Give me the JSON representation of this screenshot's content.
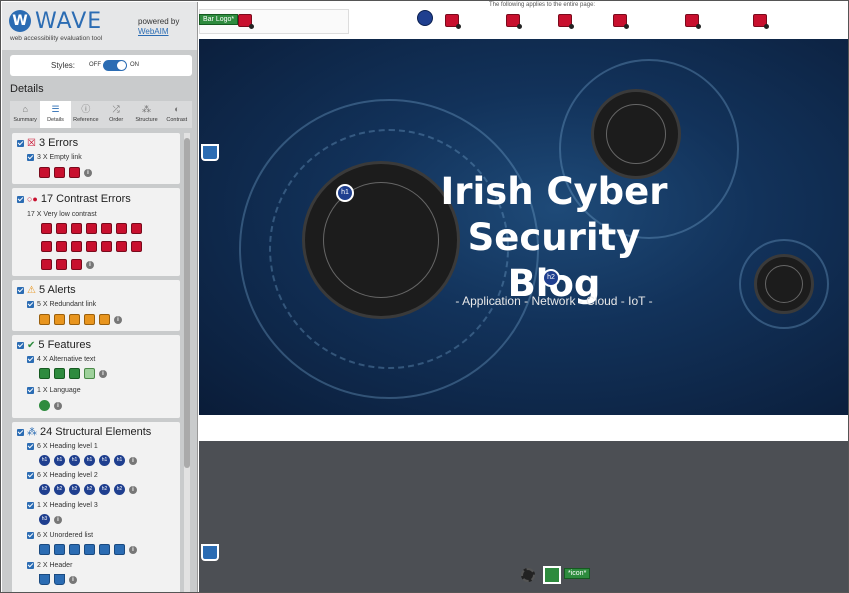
{
  "wave": {
    "logo_letter": "W",
    "title": "WAVE",
    "subtitle": "web accessibility evaluation tool",
    "powered_by": "powered by",
    "webaim": "WebAIM",
    "styles_label": "Styles:",
    "styles_off": "OFF",
    "styles_on": "ON",
    "details_heading": "Details",
    "tabs": [
      {
        "label": "Summary",
        "icon": "home-icon"
      },
      {
        "label": "Details",
        "icon": "list-icon"
      },
      {
        "label": "Reference",
        "icon": "info-icon"
      },
      {
        "label": "Order",
        "icon": "order-icon"
      },
      {
        "label": "Structure",
        "icon": "structure-icon"
      },
      {
        "label": "Contrast",
        "icon": "contrast-icon"
      }
    ],
    "active_tab": "Details",
    "sections": {
      "errors": {
        "title": "3 Errors",
        "items": [
          {
            "label": "3 X Empty link",
            "count": 3
          }
        ]
      },
      "contrast": {
        "title": "17 Contrast Errors",
        "items": [
          {
            "label": "17 X Very low contrast",
            "count": 17
          }
        ]
      },
      "alerts": {
        "title": "5 Alerts",
        "items": [
          {
            "label": "5 X Redundant link",
            "count": 5
          }
        ]
      },
      "features": {
        "title": "5 Features",
        "items": [
          {
            "label": "4 X Alternative text",
            "count": 4
          },
          {
            "label": "1 X Language",
            "count": 1
          }
        ]
      },
      "structure": {
        "title": "24 Structural Elements",
        "items": [
          {
            "label": "6 X Heading level 1",
            "count": 6
          },
          {
            "label": "6 X Heading level 2",
            "count": 6
          },
          {
            "label": "1 X Heading level 3",
            "count": 1
          },
          {
            "label": "6 X Unordered list",
            "count": 6
          },
          {
            "label": "2 X Header",
            "count": 2
          }
        ]
      }
    },
    "info_glyph": "i"
  },
  "page": {
    "top_note": "The following applies to the entire page:",
    "logo_tag": "Bar Logo*",
    "hero_title_line1": "Irish Cyber Security",
    "hero_title_line2": "Blog",
    "hero_subtitle": "- Application - Network - Cloud - IoT -",
    "h1_badge": "h1",
    "h2_badge": "h2",
    "icon_tag": "*icon*"
  },
  "colors": {
    "wave_blue": "#2b6cb3",
    "error_red": "#c8102e",
    "alert_orange": "#e8951e",
    "feature_green": "#2e8b3e",
    "structure_navy": "#1f3f8f"
  }
}
